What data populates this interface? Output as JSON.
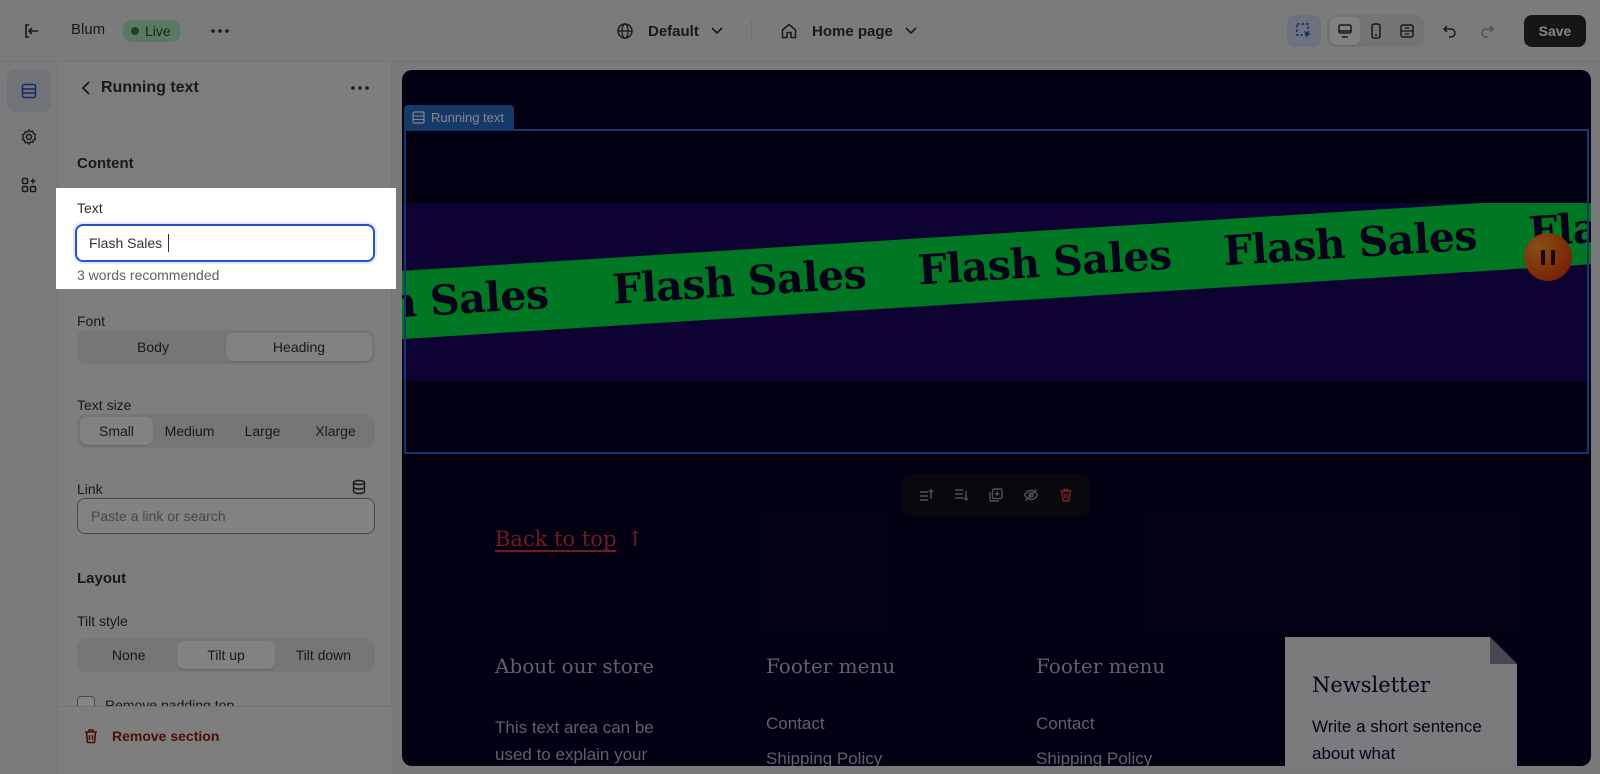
{
  "topbar": {
    "store_name": "Blum",
    "live_label": "Live",
    "theme_label": "Default",
    "page_label": "Home page",
    "save_label": "Save"
  },
  "panel": {
    "title": "Running text",
    "content_heading": "Content",
    "text_label": "Text",
    "text_value": "Flash Sales",
    "text_hint": "3 words recommended",
    "font_label": "Font",
    "font_options": [
      "Body",
      "Heading"
    ],
    "font_selected": "Heading",
    "size_label": "Text size",
    "size_options": [
      "Small",
      "Medium",
      "Large",
      "Xlarge"
    ],
    "size_selected": "Small",
    "link_label": "Link",
    "link_placeholder": "Paste a link or search",
    "layout_heading": "Layout",
    "tilt_label": "Tilt style",
    "tilt_options": [
      "None",
      "Tilt up",
      "Tilt down"
    ],
    "tilt_selected": "Tilt up",
    "padding_top_label": "Remove padding top",
    "remove_section_label": "Remove section"
  },
  "preview": {
    "section_tag": "Running text",
    "marquee_items": [
      "h Sales",
      "Flash Sales",
      "Flash Sales",
      "Flash Sales",
      "Fla"
    ],
    "back_to_top": "Back to top",
    "back_to_top_arrow": "↑",
    "footer": {
      "about_heading": "About our store",
      "about_text": "This text area can be used to explain your",
      "menu1_heading": "Footer menu",
      "menu1_items": [
        "Contact",
        "Shipping Policy"
      ],
      "menu2_heading": "Footer menu",
      "menu2_items": [
        "Contact",
        "Shipping Policy"
      ],
      "newsletter_heading": "Newsletter",
      "newsletter_text": "Write a short sentence about what"
    }
  },
  "colors": {
    "accent": "#2c4fc4",
    "marquee_strip": "#00e541",
    "preview_bg": "#050124",
    "band_bg": "#1c0562",
    "link_red": "#d43b3b"
  }
}
